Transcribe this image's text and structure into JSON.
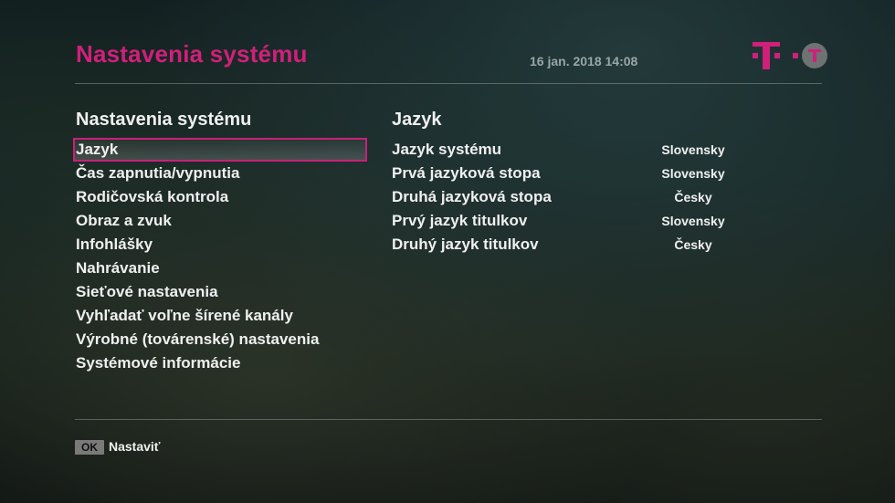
{
  "header": {
    "title": "Nastavenia systému",
    "datetime": "16 jan. 2018 14:08"
  },
  "colors": {
    "accent": "#d0207a",
    "text": "#f0f0f0"
  },
  "left_panel": {
    "heading": "Nastavenia systému",
    "items": [
      {
        "label": "Jazyk",
        "selected": true
      },
      {
        "label": "Čas zapnutia/vypnutia"
      },
      {
        "label": "Rodičovská kontrola"
      },
      {
        "label": "Obraz a zvuk"
      },
      {
        "label": "Infohlášky"
      },
      {
        "label": "Nahrávanie"
      },
      {
        "label": "Sieťové nastavenia"
      },
      {
        "label": "Vyhľadať voľne šírené kanály"
      },
      {
        "label": "Výrobné (továrenské) nastavenia"
      },
      {
        "label": "Systémové informácie"
      }
    ]
  },
  "right_panel": {
    "heading": "Jazyk",
    "settings": [
      {
        "label": "Jazyk systému",
        "value": "Slovensky"
      },
      {
        "label": "Prvá jazyková stopa",
        "value": "Slovensky"
      },
      {
        "label": "Druhá jazyková stopa",
        "value": "Česky"
      },
      {
        "label": "Prvý jazyk titulkov",
        "value": "Slovensky"
      },
      {
        "label": "Druhý jazyk titulkov",
        "value": "Česky"
      }
    ]
  },
  "footer": {
    "ok_key": "OK",
    "ok_action": "Nastaviť"
  },
  "icons": {
    "logo": "telekom-logo-icon",
    "ok": "ok-key-icon"
  }
}
